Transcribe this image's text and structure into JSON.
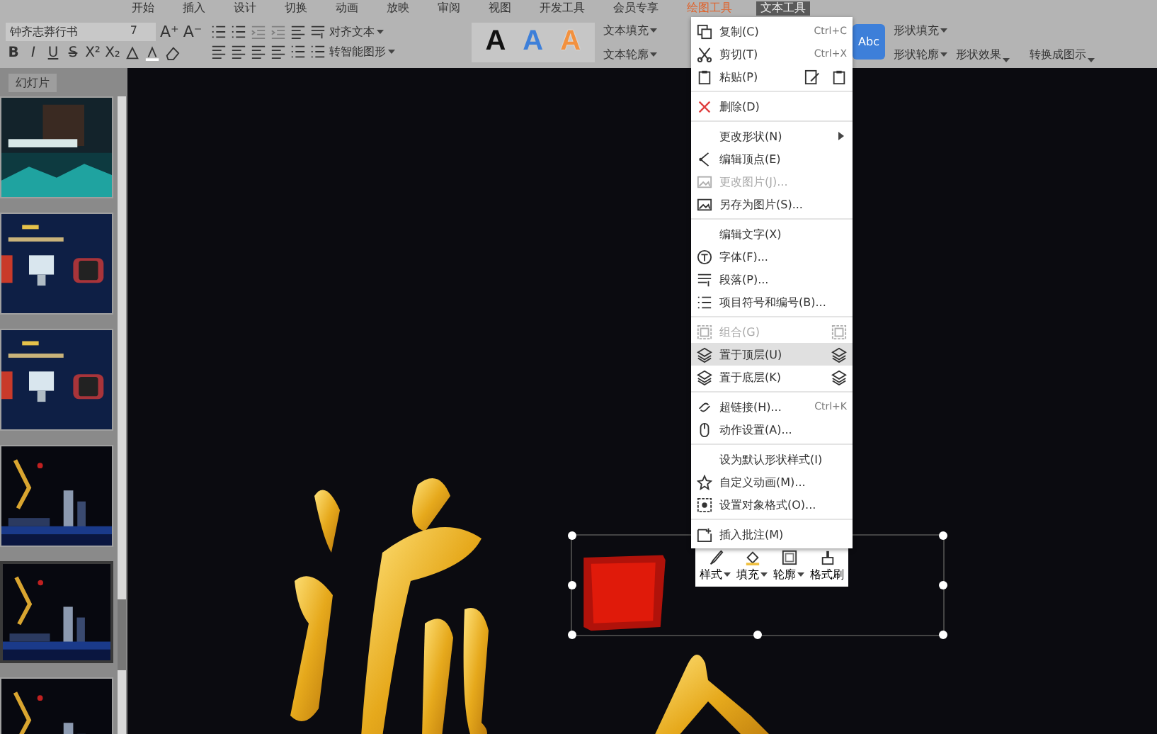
{
  "menu_tabs": [
    {
      "label": "开始",
      "selected": false,
      "contextual": false
    },
    {
      "label": "插入",
      "selected": false,
      "contextual": false
    },
    {
      "label": "设计",
      "selected": false,
      "contextual": false
    },
    {
      "label": "切换",
      "selected": false,
      "contextual": false
    },
    {
      "label": "动画",
      "selected": false,
      "contextual": false
    },
    {
      "label": "放映",
      "selected": false,
      "contextual": false
    },
    {
      "label": "审阅",
      "selected": false,
      "contextual": false
    },
    {
      "label": "视图",
      "selected": false,
      "contextual": false
    },
    {
      "label": "开发工具",
      "selected": false,
      "contextual": false
    },
    {
      "label": "会员专享",
      "selected": false,
      "contextual": false
    },
    {
      "label": "绘图工具",
      "selected": false,
      "contextual": true
    },
    {
      "label": "文本工具",
      "selected": true,
      "contextual": false
    }
  ],
  "ribbon": {
    "font_name": "钟齐志莽行书",
    "font_size": "7",
    "grow_font": "A⁺",
    "shrink_font": "A⁻",
    "format_buttons": [
      "B",
      "I",
      "U",
      "S",
      "X²",
      "X₂"
    ],
    "align_text": "对齐文本",
    "smart_art": "转智能图形",
    "text_styles": [
      {
        "label": "A",
        "color": "#111111"
      },
      {
        "label": "A",
        "color": "#3d7fd9"
      },
      {
        "label": "A",
        "color": "#f2913f"
      }
    ],
    "text_fill": "文本填充",
    "text_outline": "文本轮廓",
    "shape_style": "Abc",
    "shape_fill": "形状填充",
    "shape_outline": "形状轮廓",
    "shape_effects": "形状效果",
    "convert": "转换成图示"
  },
  "sidebar": {
    "tab": "幻灯片",
    "thumbnails": [
      {
        "kind": "picture",
        "selected": false
      },
      {
        "kind": "picture",
        "selected": false
      },
      {
        "kind": "picture",
        "selected": false
      },
      {
        "kind": "picture",
        "selected": false
      },
      {
        "kind": "picture",
        "selected": true
      },
      {
        "kind": "picture",
        "selected": false
      }
    ]
  },
  "context_menu": {
    "groups": [
      [
        {
          "label": "复制(C)",
          "shortcut": "Ctrl+C",
          "disabled": false,
          "selected": false,
          "submenu": false
        },
        {
          "label": "剪切(T)",
          "shortcut": "Ctrl+X",
          "disabled": false,
          "selected": false,
          "submenu": false
        },
        {
          "label": "粘贴(P)",
          "disabled": false,
          "selected": false,
          "submenu": false
        }
      ],
      [
        {
          "label": "删除(D)",
          "disabled": false,
          "selected": false,
          "submenu": false
        }
      ],
      [
        {
          "label": "更改形状(N)",
          "disabled": false,
          "selected": false,
          "submenu": true
        },
        {
          "label": "编辑顶点(E)",
          "disabled": false,
          "selected": false,
          "submenu": false
        },
        {
          "label": "更改图片(J)...",
          "disabled": true,
          "selected": false,
          "submenu": false
        },
        {
          "label": "另存为图片(S)...",
          "disabled": false,
          "selected": false,
          "submenu": false
        }
      ],
      [
        {
          "label": "编辑文字(X)",
          "disabled": false,
          "selected": false,
          "submenu": false
        },
        {
          "label": "字体(F)...",
          "disabled": false,
          "selected": false,
          "submenu": false
        },
        {
          "label": "段落(P)...",
          "disabled": false,
          "selected": false,
          "submenu": false
        },
        {
          "label": "项目符号和编号(B)...",
          "disabled": false,
          "selected": false,
          "submenu": false
        }
      ],
      [
        {
          "label": "组合(G)",
          "disabled": true,
          "selected": false,
          "submenu": false
        },
        {
          "label": "置于顶层(U)",
          "disabled": false,
          "selected": true,
          "submenu": false
        },
        {
          "label": "置于底层(K)",
          "disabled": false,
          "selected": false,
          "submenu": false
        }
      ],
      [
        {
          "label": "超链接(H)...",
          "shortcut": "Ctrl+K",
          "disabled": false,
          "selected": false,
          "submenu": false
        },
        {
          "label": "动作设置(A)...",
          "disabled": false,
          "selected": false,
          "submenu": false
        }
      ],
      [
        {
          "label": "设为默认形状样式(I)",
          "disabled": false,
          "selected": false,
          "submenu": false
        },
        {
          "label": "自定义动画(M)...",
          "disabled": false,
          "selected": false,
          "submenu": false
        },
        {
          "label": "设置对象格式(O)...",
          "disabled": false,
          "selected": false,
          "submenu": false
        }
      ],
      [
        {
          "label": "插入批注(M)",
          "disabled": false,
          "selected": false,
          "submenu": false
        }
      ]
    ]
  },
  "mini_toolbar": [
    {
      "label": "样式",
      "dropdown": true
    },
    {
      "label": "填充",
      "dropdown": true
    },
    {
      "label": "轮廓",
      "dropdown": true
    },
    {
      "label": "格式刷",
      "dropdown": false
    }
  ]
}
